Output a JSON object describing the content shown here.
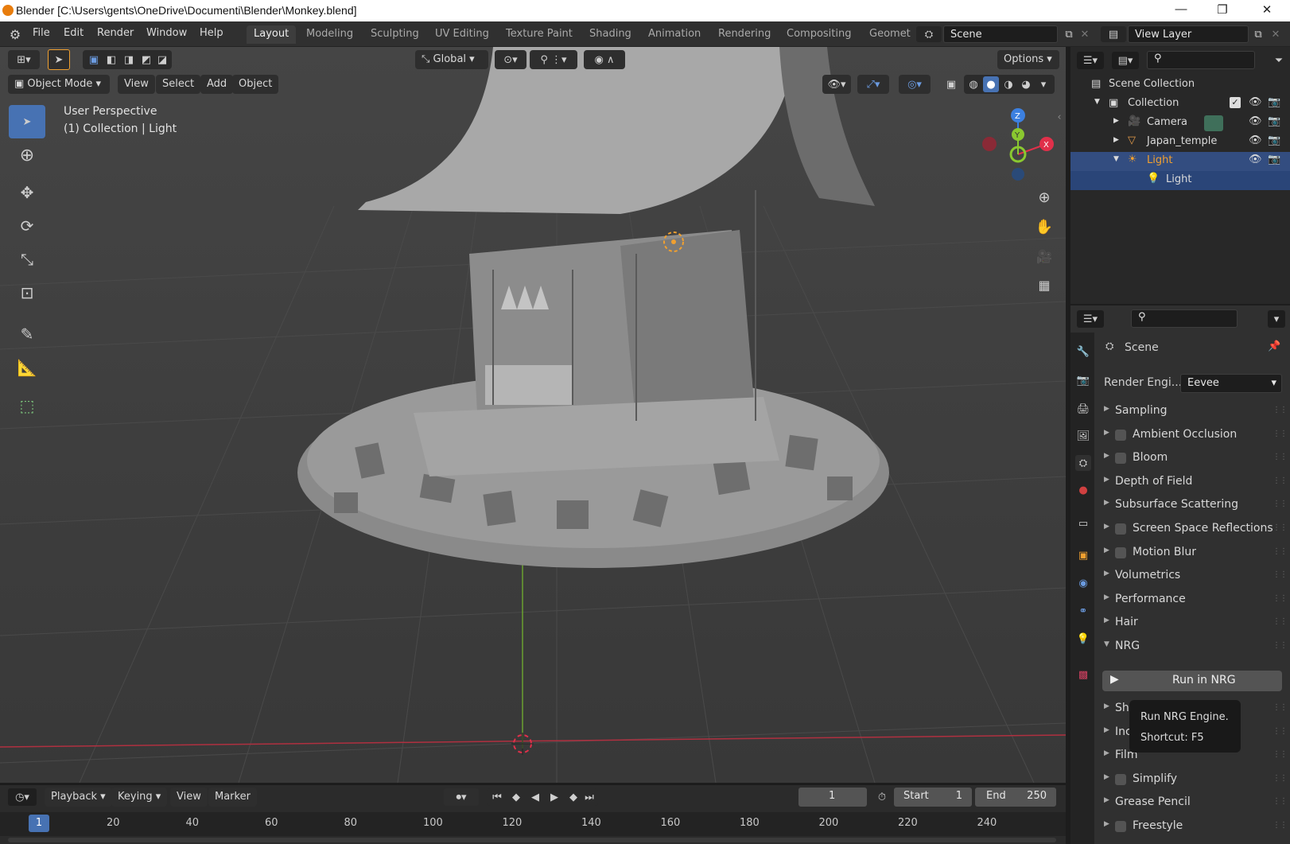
{
  "window": {
    "title": "Blender [C:\\Users\\gents\\OneDrive\\Documenti\\Blender\\Monkey.blend]",
    "controls": [
      "—",
      "❐",
      "✕"
    ]
  },
  "menubar": {
    "items": [
      "File",
      "Edit",
      "Render",
      "Window",
      "Help"
    ]
  },
  "workspaces": [
    "Layout",
    "Modeling",
    "Sculpting",
    "UV Editing",
    "Texture Paint",
    "Shading",
    "Animation",
    "Rendering",
    "Compositing",
    "Geomet"
  ],
  "scene_field": "Scene",
  "viewlayer_field": "View Layer",
  "viewport_header": {
    "transform_orientation": "Global",
    "options_label": "Options",
    "mode": "Object Mode",
    "menus": [
      "View",
      "Select",
      "Add",
      "Object"
    ]
  },
  "viewport_overlay": {
    "perspective": "User Perspective",
    "context": "(1) Collection | Light"
  },
  "gizmo": {
    "axes": [
      "Z",
      "Y",
      "X"
    ]
  },
  "outliner": {
    "root": "Scene Collection",
    "collection": "Collection",
    "items": [
      {
        "name": "Camera",
        "icon": "camera-icon"
      },
      {
        "name": "Japan_temple",
        "icon": "mesh-icon"
      },
      {
        "name": "Light",
        "icon": "light-icon"
      }
    ],
    "child": "Light"
  },
  "properties": {
    "context_label": "Scene",
    "render_engine_label": "Render Engi...",
    "render_engine_value": "Eevee",
    "panels": [
      {
        "label": "Sampling",
        "checkbox": false,
        "expanded": false
      },
      {
        "label": "Ambient Occlusion",
        "checkbox": true,
        "expanded": false
      },
      {
        "label": "Bloom",
        "checkbox": true,
        "expanded": false
      },
      {
        "label": "Depth of Field",
        "checkbox": false,
        "expanded": false
      },
      {
        "label": "Subsurface Scattering",
        "checkbox": false,
        "expanded": false
      },
      {
        "label": "Screen Space Reflections",
        "checkbox": true,
        "expanded": false
      },
      {
        "label": "Motion Blur",
        "checkbox": true,
        "expanded": false
      },
      {
        "label": "Volumetrics",
        "checkbox": false,
        "expanded": false
      },
      {
        "label": "Performance",
        "checkbox": false,
        "expanded": false
      },
      {
        "label": "Hair",
        "checkbox": false,
        "expanded": false
      },
      {
        "label": "NRG",
        "checkbox": false,
        "expanded": true
      }
    ],
    "nrg_button": "Run in NRG",
    "panels_after": [
      {
        "label": "Sh",
        "checkbox": false
      },
      {
        "label": "Inc",
        "checkbox": false
      },
      {
        "label": "Film",
        "checkbox": false
      },
      {
        "label": "Simplify",
        "checkbox": true
      },
      {
        "label": "Grease Pencil",
        "checkbox": false
      },
      {
        "label": "Freestyle",
        "checkbox": true
      }
    ],
    "tooltip_title": "Run NRG Engine.",
    "tooltip_shortcut": "Shortcut: F5"
  },
  "timeline": {
    "menus": [
      "Playback",
      "Keying",
      "View",
      "Marker"
    ],
    "current_frame": "1",
    "start_label": "Start",
    "start_value": "1",
    "end_label": "End",
    "end_value": "250",
    "ruler": [
      "20",
      "40",
      "60",
      "80",
      "100",
      "120",
      "140",
      "160",
      "180",
      "200",
      "220",
      "240"
    ],
    "playhead": "1"
  },
  "colors": {
    "accent": "#4772b3",
    "light_orange": "#f0a030",
    "axis_x": "#e0304a",
    "axis_y": "#8ac830",
    "axis_z": "#3c80e0"
  }
}
